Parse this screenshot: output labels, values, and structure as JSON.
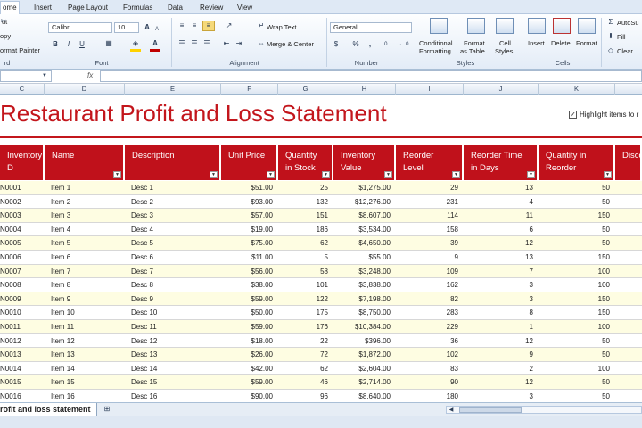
{
  "ribbon": {
    "tabs": [
      {
        "label": "ome",
        "active": true
      },
      {
        "label": "Insert",
        "active": false
      },
      {
        "label": "Page Layout",
        "active": false
      },
      {
        "label": "Formulas",
        "active": false
      },
      {
        "label": "Data",
        "active": false
      },
      {
        "label": "Review",
        "active": false
      },
      {
        "label": "View",
        "active": false
      }
    ],
    "clipboard": {
      "cut": "ut",
      "copy": "opy",
      "format_painter": "ormat Painter",
      "title": "rd"
    },
    "font": {
      "name": "Calibri",
      "size": "10",
      "bold": "B",
      "italic": "I",
      "underline": "U",
      "grow": "A",
      "shrink": "A",
      "fill_color": "#ffd200",
      "font_color": "#c00000",
      "title": "Font"
    },
    "alignment": {
      "wrap_text": "Wrap Text",
      "merge_center": "Merge & Center",
      "title": "Alignment"
    },
    "number": {
      "format": "General",
      "currency": "$",
      "percent": "%",
      "comma": ",",
      "title": "Number"
    },
    "styles": {
      "conditional": "Conditional",
      "conditional2": "Formatting",
      "format_table": "Format",
      "format_table2": "as Table",
      "cell_styles": "Cell",
      "cell_styles2": "Styles",
      "title": "Styles"
    },
    "cells": {
      "insert": "Insert",
      "delete": "Delete",
      "format": "Format",
      "title": "Cells"
    },
    "editing": {
      "autosum": "AutoSu",
      "fill": "Fill",
      "clear": "Clear"
    }
  },
  "formula_bar": {
    "fx": "fx",
    "value": ""
  },
  "columns": [
    "C",
    "D",
    "E",
    "F",
    "G",
    "H",
    "I",
    "J",
    "K"
  ],
  "sheet": {
    "title": "Restaurant Profit and Loss Statement",
    "highlight_label": "Highlight items to r",
    "highlight_checked": true,
    "headers": [
      [
        "Inventory",
        "D"
      ],
      [
        "Name"
      ],
      [
        "Description"
      ],
      [
        "Unit Price"
      ],
      [
        "Quantity",
        "in Stock"
      ],
      [
        "Inventory",
        "Value"
      ],
      [
        "Reorder",
        "Level"
      ],
      [
        "Reorder Time",
        "in Days"
      ],
      [
        "Quantity in",
        "Reorder"
      ],
      [
        "Disco"
      ]
    ],
    "rows": [
      [
        "N0001",
        "Item 1",
        "Desc 1",
        "$51.00",
        "25",
        "$1,275.00",
        "29",
        "13",
        "50"
      ],
      [
        "N0002",
        "Item 2",
        "Desc 2",
        "$93.00",
        "132",
        "$12,276.00",
        "231",
        "4",
        "50"
      ],
      [
        "N0003",
        "Item 3",
        "Desc 3",
        "$57.00",
        "151",
        "$8,607.00",
        "114",
        "11",
        "150"
      ],
      [
        "N0004",
        "Item 4",
        "Desc 4",
        "$19.00",
        "186",
        "$3,534.00",
        "158",
        "6",
        "50"
      ],
      [
        "N0005",
        "Item 5",
        "Desc 5",
        "$75.00",
        "62",
        "$4,650.00",
        "39",
        "12",
        "50"
      ],
      [
        "N0006",
        "Item 6",
        "Desc 6",
        "$11.00",
        "5",
        "$55.00",
        "9",
        "13",
        "150"
      ],
      [
        "N0007",
        "Item 7",
        "Desc 7",
        "$56.00",
        "58",
        "$3,248.00",
        "109",
        "7",
        "100"
      ],
      [
        "N0008",
        "Item 8",
        "Desc 8",
        "$38.00",
        "101",
        "$3,838.00",
        "162",
        "3",
        "100"
      ],
      [
        "N0009",
        "Item 9",
        "Desc 9",
        "$59.00",
        "122",
        "$7,198.00",
        "82",
        "3",
        "150"
      ],
      [
        "N0010",
        "Item 10",
        "Desc 10",
        "$50.00",
        "175",
        "$8,750.00",
        "283",
        "8",
        "150"
      ],
      [
        "N0011",
        "Item 11",
        "Desc 11",
        "$59.00",
        "176",
        "$10,384.00",
        "229",
        "1",
        "100"
      ],
      [
        "N0012",
        "Item 12",
        "Desc 12",
        "$18.00",
        "22",
        "$396.00",
        "36",
        "12",
        "50"
      ],
      [
        "N0013",
        "Item 13",
        "Desc 13",
        "$26.00",
        "72",
        "$1,872.00",
        "102",
        "9",
        "50"
      ],
      [
        "N0014",
        "Item 14",
        "Desc 14",
        "$42.00",
        "62",
        "$2,604.00",
        "83",
        "2",
        "100"
      ],
      [
        "N0015",
        "Item 15",
        "Desc 15",
        "$59.00",
        "46",
        "$2,714.00",
        "90",
        "12",
        "50"
      ],
      [
        "N0016",
        "Item 16",
        "Desc 16",
        "$90.00",
        "96",
        "$8,640.00",
        "180",
        "3",
        "50"
      ]
    ],
    "tab_name": "rofit and loss statement"
  },
  "colors": {
    "accent_red": "#c0111b",
    "row_yellow": "#fefde2"
  }
}
